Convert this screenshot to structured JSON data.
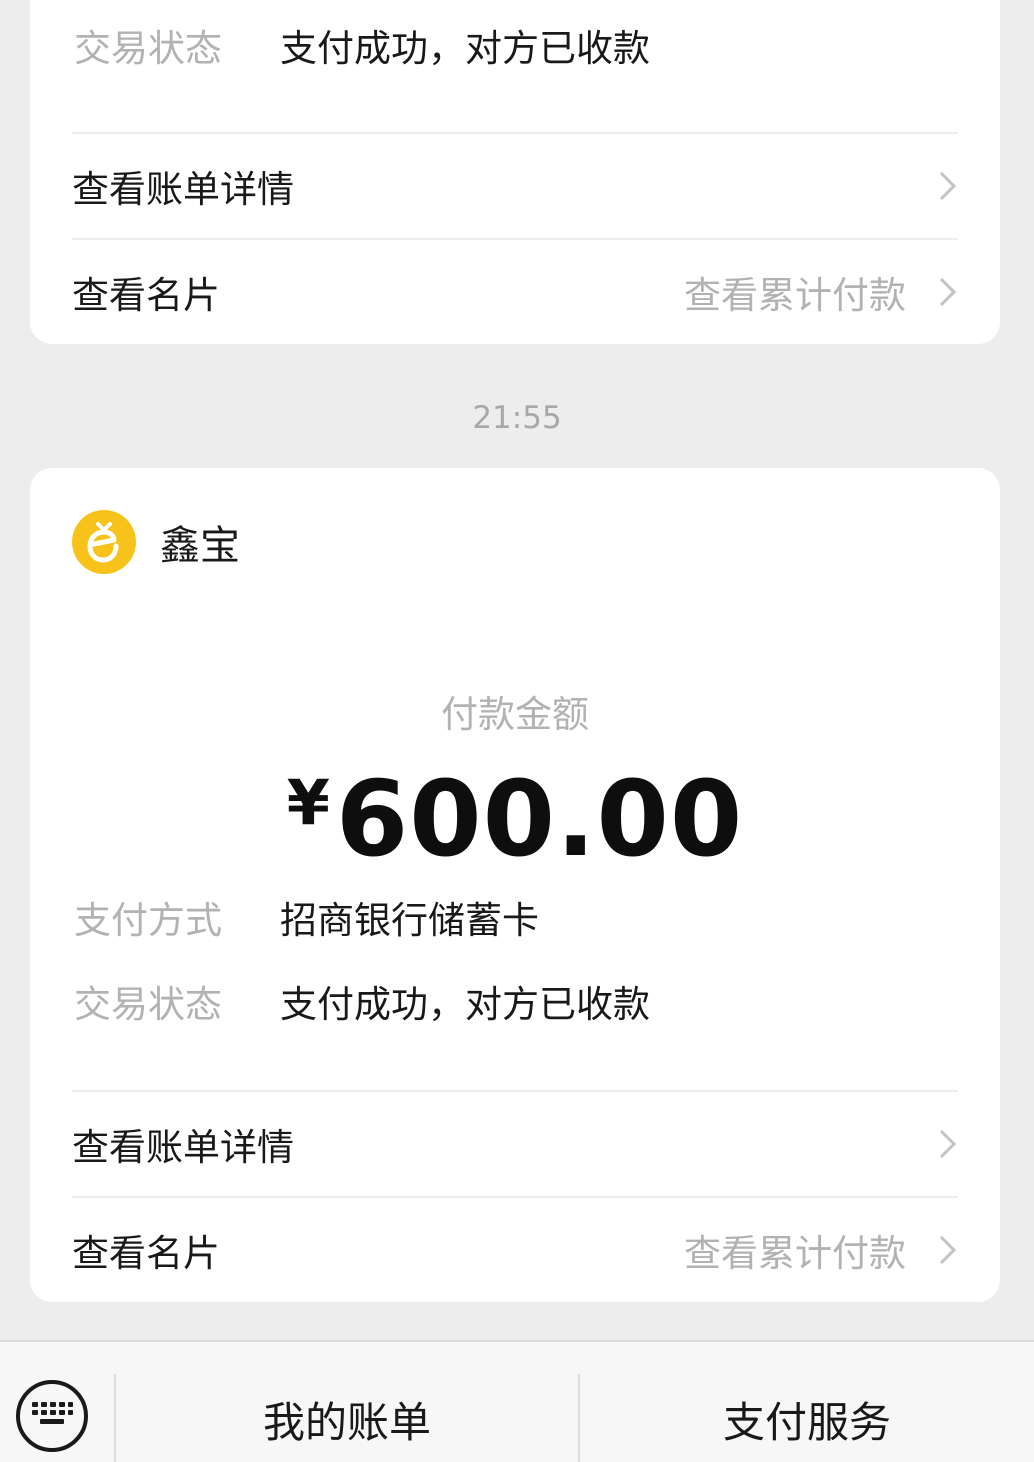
{
  "top_card": {
    "status_label": "交易状态",
    "status_value": "支付成功，对方已收款",
    "bill_details": "查看账单详情",
    "view_card": "查看名片",
    "cumulative": "查看累计付款"
  },
  "timestamp": "21:55",
  "main_card": {
    "merchant_name": "鑫宝",
    "merchant_logo_icon": "merchant-logo-icon",
    "merchant_logo_color": "#f7c31a",
    "amount_label": "付款金额",
    "currency": "¥",
    "amount": "600.00",
    "method_label": "支付方式",
    "method_value": "招商银行储蓄卡",
    "status_label": "交易状态",
    "status_value": "支付成功，对方已收款",
    "bill_details": "查看账单详情",
    "view_card": "查看名片",
    "cumulative": "查看累计付款"
  },
  "bottom_bar": {
    "keyboard_icon": "keyboard-icon",
    "my_bills": "我的账单",
    "pay_services": "支付服务"
  }
}
